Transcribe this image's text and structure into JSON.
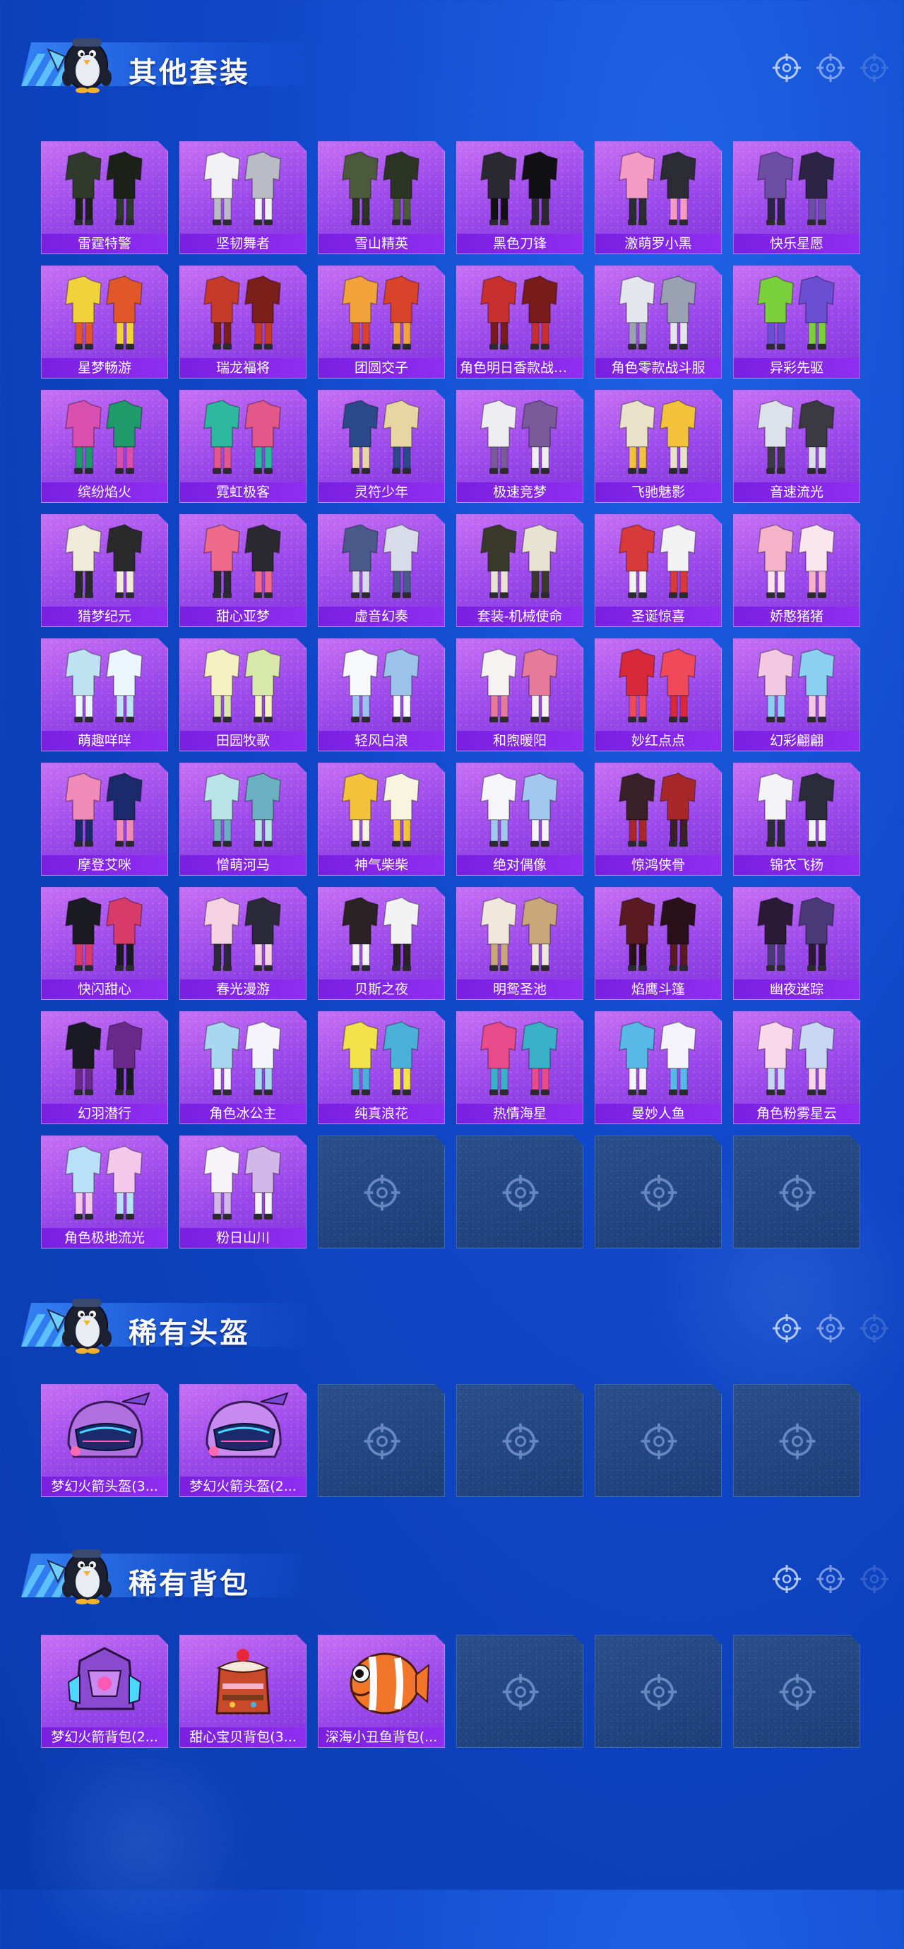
{
  "sections": [
    {
      "title": "其他套装",
      "item_kind": "outfit",
      "items": [
        "雷霆特警",
        "坚韧舞者",
        "雪山精英",
        "黑色刀锋",
        "激萌罗小黑",
        "快乐星愿",
        "星梦畅游",
        "瑞龙福将",
        "团圆交子",
        "角色明日香款战斗...",
        "角色零款战斗服",
        "异彩先驱",
        "缤纷焰火",
        "霓虹极客",
        "灵符少年",
        "极速竞梦",
        "飞驰魅影",
        "音速流光",
        "猎梦纪元",
        "甜心亚梦",
        "虚音幻奏",
        "套装-机械使命",
        "圣诞惊喜",
        "娇憨猪猪",
        "萌趣咩咩",
        "田园牧歌",
        "轻风白浪",
        "和煦暖阳",
        "妙红点点",
        "幻彩翩翩",
        "摩登艾咪",
        "憎萌河马",
        "神气柴柴",
        "绝对偶像",
        "惊鸿侠骨",
        "锦衣飞扬",
        "快闪甜心",
        "春光漫游",
        "贝斯之夜",
        "明鸳圣池",
        "焰鹰斗篷",
        "幽夜迷踪",
        "幻羽潜行",
        "角色冰公主",
        "纯真浪花",
        "热情海星",
        "曼妙人鱼",
        "角色粉雾星云",
        "角色极地流光",
        "粉日山川"
      ],
      "empty_slots": 4
    },
    {
      "title": "稀有头盔",
      "item_kind": "helmet",
      "items": [
        "梦幻火箭头盔(3...",
        "梦幻火箭头盔(2..."
      ],
      "empty_slots": 4
    },
    {
      "title": "稀有背包",
      "item_kind": "backpack",
      "items": [
        "梦幻火箭背包(2...",
        "甜心宝贝背包(3...",
        "深海小丑鱼背包(..."
      ],
      "empty_slots": 3
    }
  ],
  "colors": {
    "background": "#0f46c8",
    "card_purple": "#a24cec",
    "label_purple": "#7a1fe0",
    "empty_slot": "#1d3f78"
  },
  "icons": {
    "header_mascot": "penguin-mascot-icon",
    "header_reticle": "crosshair-reticle-icon",
    "empty_slot": "crosshair-reticle-icon"
  }
}
